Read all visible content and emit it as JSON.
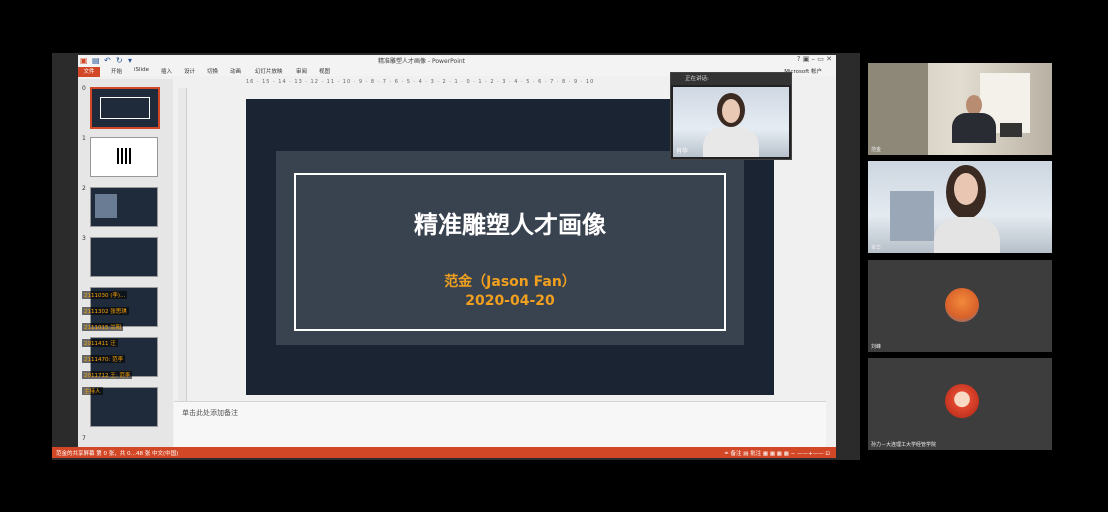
{
  "ppt": {
    "title": "精准雕塑人才画像 - PowerPoint",
    "window_controls": "?  ▣  –  ▭  ✕",
    "account": "Microsoft 帐户",
    "tabs": [
      "文件",
      "开始",
      "iSlide",
      "插入",
      "设计",
      "切换",
      "动画",
      "幻灯片放映",
      "审阅",
      "视图"
    ],
    "ruler": "16 · 15 · 14 · 13 · 12 · 11 · 10 · 9 · 8 · 7 · 6 · 5 · 4 · 3 · 2 · 1 · 0 · 1 · 2 · 3 · 4 · 5 · 6 · 7 · 8 · 9 · 10",
    "thumbnails": [
      "0",
      "1",
      "2",
      "3",
      "7"
    ],
    "chat_overlay": [
      "2111030 (李)...",
      "2111302 张思琪",
      "2111015 兰阳",
      "2011411 汪",
      "2111470: 范李",
      "2011712 王: 范李",
      "主持人"
    ],
    "slide": {
      "title": "精准雕塑人才画像",
      "name": "范金（Jason Fan）",
      "date": "2020-04-20"
    },
    "notes_placeholder": "单击此处添加备注",
    "status_left": "范金的共享屏幕   第 0 张，共 0…48 张   中文(中国)",
    "status_right": "≐ 备注   ▤ 批注   ▦  ▦  ▦  ▦   − ——+——  ⊡"
  },
  "speaker": {
    "header": "正在讲话:",
    "name": "肖华"
  },
  "participants": [
    {
      "name": "范金",
      "kind": "video-office"
    },
    {
      "name": "肖华",
      "kind": "video-woman"
    },
    {
      "name": "刘峰",
      "kind": "avatar-orange"
    },
    {
      "name": "孙力－大连理工大学经管学院",
      "kind": "avatar-red"
    }
  ],
  "colors": {
    "ppt_accent": "#d24726",
    "slide_bg": "#1b2433",
    "slide_inner": "#39424f",
    "title_orange": "#f0a01e"
  }
}
